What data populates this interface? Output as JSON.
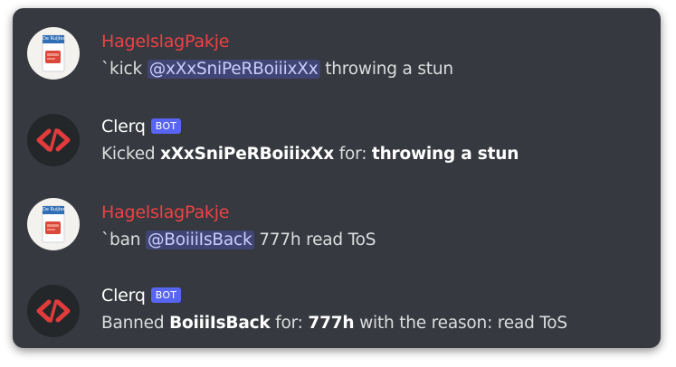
{
  "colors": {
    "card_bg": "#36393f",
    "user_name_color": "#ed4245",
    "bot_name_color": "#ffffff",
    "text_color": "#dcddde",
    "mention_color": "#c9cdfb",
    "bot_badge_bg": "#5865f2"
  },
  "messages": [
    {
      "author": "HagelslagPakje",
      "avatar_icon": "hagelslag-box-icon",
      "avatar_text": "De Ruijter",
      "command": "`kick",
      "mention": "@xXxSniPeRBoiiixXx",
      "rest": "throwing a stun"
    },
    {
      "author": "Clerq",
      "badge": "BOT",
      "avatar_icon": "code-brackets-icon",
      "prefix": "Kicked",
      "target": "xXxSniPeRBoiiixXx",
      "for_label": "for:",
      "reason": "throwing a stun"
    },
    {
      "author": "HagelslagPakje",
      "avatar_icon": "hagelslag-box-icon",
      "avatar_text": "De Ruijter",
      "command": "`ban",
      "mention": "@BoiiiIsBack",
      "rest": "777h read ToS"
    },
    {
      "author": "Clerq",
      "badge": "BOT",
      "avatar_icon": "code-brackets-icon",
      "prefix": "Banned",
      "target": "BoiiiIsBack",
      "for_label": "for:",
      "duration": "777h",
      "reason_label": "with the reason:",
      "reason": "read ToS"
    }
  ]
}
